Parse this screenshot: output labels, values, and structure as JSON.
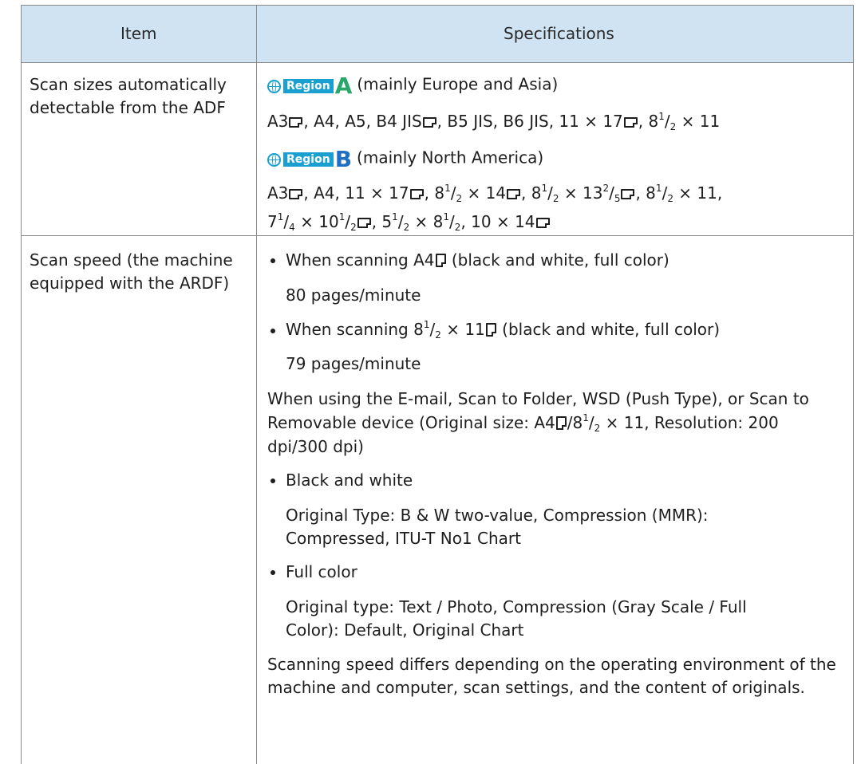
{
  "table": {
    "header_item": "Item",
    "header_specifications": "Specifications",
    "row1": {
      "item_line1": "Scan sizes automatically",
      "item_line2": "detectable from the ADF",
      "region_label": "Region",
      "region_a_letter": "A",
      "region_a_desc": "(mainly Europe and Asia)",
      "region_b_letter": "B",
      "region_b_desc": "(mainly North America)",
      "region_a_color": "#2aa86a",
      "region_b_color": "#1f6fc4"
    },
    "row2": {
      "item_line1": "Scan speed (the machine",
      "item_line2": "equipped with the ARDF)",
      "pages_a4": "80 pages/minute",
      "pages_letter": "79 pages/minute",
      "bw_label": "Black and white",
      "bw_desc_line1": "Original Type: B & W two-value, Compression (MMR):",
      "bw_desc_line2": "Compressed, ITU-T No1 Chart",
      "fc_label": "Full color",
      "fc_desc_line1": "Original type: Text / Photo, Compression (Gray Scale / Full",
      "fc_desc_line2": "Color): Default, Original Chart",
      "note_line1": "Scanning speed differs depending on the operating environment of the",
      "note_line2": "machine and computer, scan settings, and the content of originals."
    }
  }
}
